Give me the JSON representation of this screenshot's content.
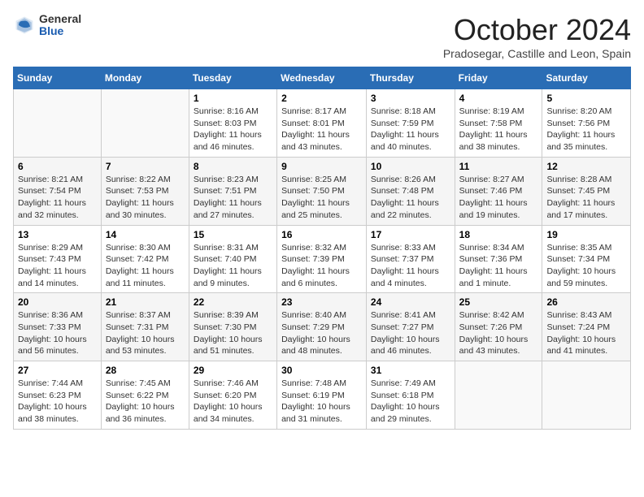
{
  "header": {
    "logo_general": "General",
    "logo_blue": "Blue",
    "month": "October 2024",
    "location": "Pradosegar, Castille and Leon, Spain"
  },
  "weekdays": [
    "Sunday",
    "Monday",
    "Tuesday",
    "Wednesday",
    "Thursday",
    "Friday",
    "Saturday"
  ],
  "weeks": [
    [
      {
        "day": "",
        "sunrise": "",
        "sunset": "",
        "daylight": ""
      },
      {
        "day": "",
        "sunrise": "",
        "sunset": "",
        "daylight": ""
      },
      {
        "day": "1",
        "sunrise": "Sunrise: 8:16 AM",
        "sunset": "Sunset: 8:03 PM",
        "daylight": "Daylight: 11 hours and 46 minutes."
      },
      {
        "day": "2",
        "sunrise": "Sunrise: 8:17 AM",
        "sunset": "Sunset: 8:01 PM",
        "daylight": "Daylight: 11 hours and 43 minutes."
      },
      {
        "day": "3",
        "sunrise": "Sunrise: 8:18 AM",
        "sunset": "Sunset: 7:59 PM",
        "daylight": "Daylight: 11 hours and 40 minutes."
      },
      {
        "day": "4",
        "sunrise": "Sunrise: 8:19 AM",
        "sunset": "Sunset: 7:58 PM",
        "daylight": "Daylight: 11 hours and 38 minutes."
      },
      {
        "day": "5",
        "sunrise": "Sunrise: 8:20 AM",
        "sunset": "Sunset: 7:56 PM",
        "daylight": "Daylight: 11 hours and 35 minutes."
      }
    ],
    [
      {
        "day": "6",
        "sunrise": "Sunrise: 8:21 AM",
        "sunset": "Sunset: 7:54 PM",
        "daylight": "Daylight: 11 hours and 32 minutes."
      },
      {
        "day": "7",
        "sunrise": "Sunrise: 8:22 AM",
        "sunset": "Sunset: 7:53 PM",
        "daylight": "Daylight: 11 hours and 30 minutes."
      },
      {
        "day": "8",
        "sunrise": "Sunrise: 8:23 AM",
        "sunset": "Sunset: 7:51 PM",
        "daylight": "Daylight: 11 hours and 27 minutes."
      },
      {
        "day": "9",
        "sunrise": "Sunrise: 8:25 AM",
        "sunset": "Sunset: 7:50 PM",
        "daylight": "Daylight: 11 hours and 25 minutes."
      },
      {
        "day": "10",
        "sunrise": "Sunrise: 8:26 AM",
        "sunset": "Sunset: 7:48 PM",
        "daylight": "Daylight: 11 hours and 22 minutes."
      },
      {
        "day": "11",
        "sunrise": "Sunrise: 8:27 AM",
        "sunset": "Sunset: 7:46 PM",
        "daylight": "Daylight: 11 hours and 19 minutes."
      },
      {
        "day": "12",
        "sunrise": "Sunrise: 8:28 AM",
        "sunset": "Sunset: 7:45 PM",
        "daylight": "Daylight: 11 hours and 17 minutes."
      }
    ],
    [
      {
        "day": "13",
        "sunrise": "Sunrise: 8:29 AM",
        "sunset": "Sunset: 7:43 PM",
        "daylight": "Daylight: 11 hours and 14 minutes."
      },
      {
        "day": "14",
        "sunrise": "Sunrise: 8:30 AM",
        "sunset": "Sunset: 7:42 PM",
        "daylight": "Daylight: 11 hours and 11 minutes."
      },
      {
        "day": "15",
        "sunrise": "Sunrise: 8:31 AM",
        "sunset": "Sunset: 7:40 PM",
        "daylight": "Daylight: 11 hours and 9 minutes."
      },
      {
        "day": "16",
        "sunrise": "Sunrise: 8:32 AM",
        "sunset": "Sunset: 7:39 PM",
        "daylight": "Daylight: 11 hours and 6 minutes."
      },
      {
        "day": "17",
        "sunrise": "Sunrise: 8:33 AM",
        "sunset": "Sunset: 7:37 PM",
        "daylight": "Daylight: 11 hours and 4 minutes."
      },
      {
        "day": "18",
        "sunrise": "Sunrise: 8:34 AM",
        "sunset": "Sunset: 7:36 PM",
        "daylight": "Daylight: 11 hours and 1 minute."
      },
      {
        "day": "19",
        "sunrise": "Sunrise: 8:35 AM",
        "sunset": "Sunset: 7:34 PM",
        "daylight": "Daylight: 10 hours and 59 minutes."
      }
    ],
    [
      {
        "day": "20",
        "sunrise": "Sunrise: 8:36 AM",
        "sunset": "Sunset: 7:33 PM",
        "daylight": "Daylight: 10 hours and 56 minutes."
      },
      {
        "day": "21",
        "sunrise": "Sunrise: 8:37 AM",
        "sunset": "Sunset: 7:31 PM",
        "daylight": "Daylight: 10 hours and 53 minutes."
      },
      {
        "day": "22",
        "sunrise": "Sunrise: 8:39 AM",
        "sunset": "Sunset: 7:30 PM",
        "daylight": "Daylight: 10 hours and 51 minutes."
      },
      {
        "day": "23",
        "sunrise": "Sunrise: 8:40 AM",
        "sunset": "Sunset: 7:29 PM",
        "daylight": "Daylight: 10 hours and 48 minutes."
      },
      {
        "day": "24",
        "sunrise": "Sunrise: 8:41 AM",
        "sunset": "Sunset: 7:27 PM",
        "daylight": "Daylight: 10 hours and 46 minutes."
      },
      {
        "day": "25",
        "sunrise": "Sunrise: 8:42 AM",
        "sunset": "Sunset: 7:26 PM",
        "daylight": "Daylight: 10 hours and 43 minutes."
      },
      {
        "day": "26",
        "sunrise": "Sunrise: 8:43 AM",
        "sunset": "Sunset: 7:24 PM",
        "daylight": "Daylight: 10 hours and 41 minutes."
      }
    ],
    [
      {
        "day": "27",
        "sunrise": "Sunrise: 7:44 AM",
        "sunset": "Sunset: 6:23 PM",
        "daylight": "Daylight: 10 hours and 38 minutes."
      },
      {
        "day": "28",
        "sunrise": "Sunrise: 7:45 AM",
        "sunset": "Sunset: 6:22 PM",
        "daylight": "Daylight: 10 hours and 36 minutes."
      },
      {
        "day": "29",
        "sunrise": "Sunrise: 7:46 AM",
        "sunset": "Sunset: 6:20 PM",
        "daylight": "Daylight: 10 hours and 34 minutes."
      },
      {
        "day": "30",
        "sunrise": "Sunrise: 7:48 AM",
        "sunset": "Sunset: 6:19 PM",
        "daylight": "Daylight: 10 hours and 31 minutes."
      },
      {
        "day": "31",
        "sunrise": "Sunrise: 7:49 AM",
        "sunset": "Sunset: 6:18 PM",
        "daylight": "Daylight: 10 hours and 29 minutes."
      },
      {
        "day": "",
        "sunrise": "",
        "sunset": "",
        "daylight": ""
      },
      {
        "day": "",
        "sunrise": "",
        "sunset": "",
        "daylight": ""
      }
    ]
  ]
}
